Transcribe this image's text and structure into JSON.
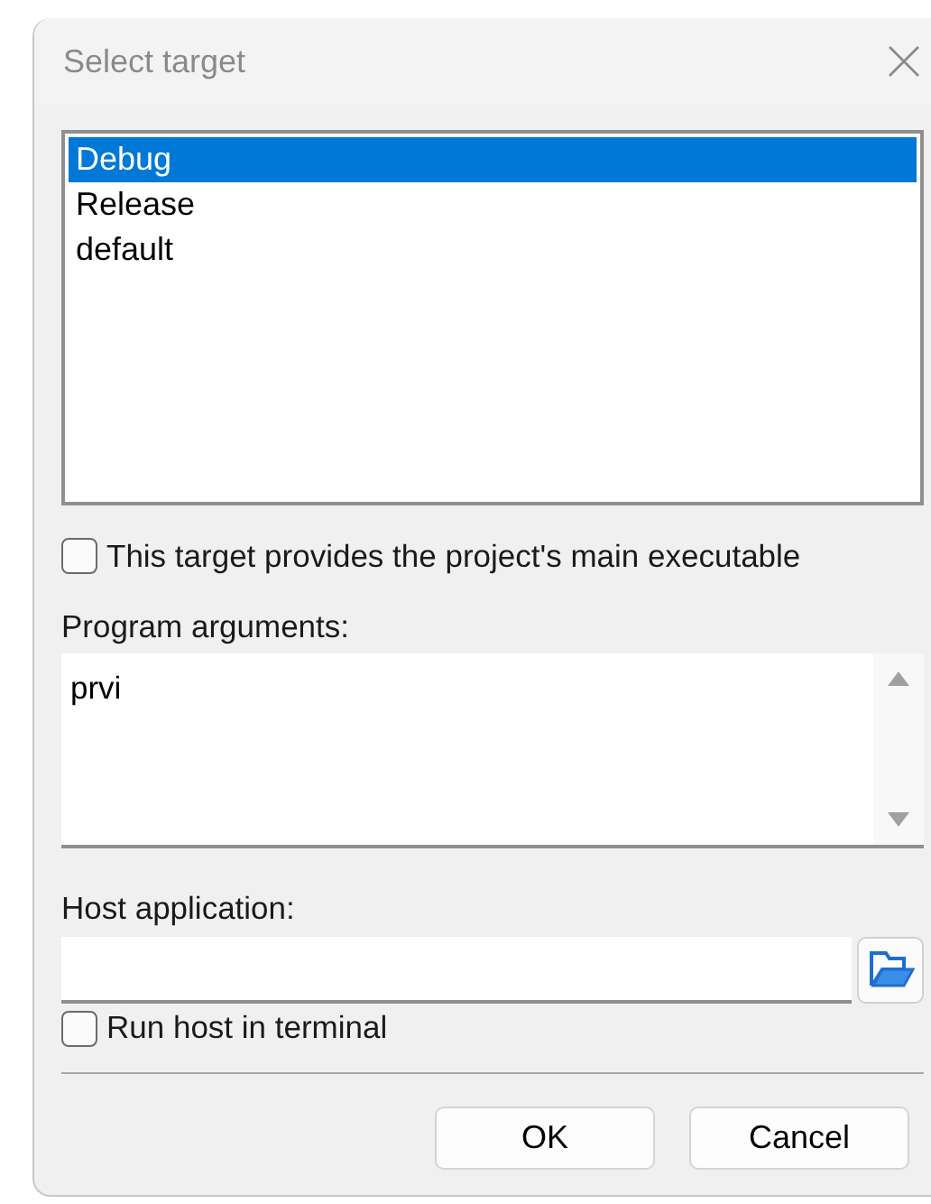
{
  "window": {
    "title": "Select target"
  },
  "targets": [
    {
      "label": "Debug",
      "selected": true
    },
    {
      "label": "Release",
      "selected": false
    },
    {
      "label": "default",
      "selected": false
    }
  ],
  "main_executable": {
    "label": "This target provides the project's main executable",
    "checked": false
  },
  "program_arguments": {
    "label": "Program arguments:",
    "value": "prvi"
  },
  "host_application": {
    "label": "Host application:"
  },
  "run_in_terminal": {
    "label": "Run host in terminal",
    "checked": false
  },
  "buttons": [
    {
      "label": "OK"
    },
    {
      "label": "Cancel"
    }
  ]
}
